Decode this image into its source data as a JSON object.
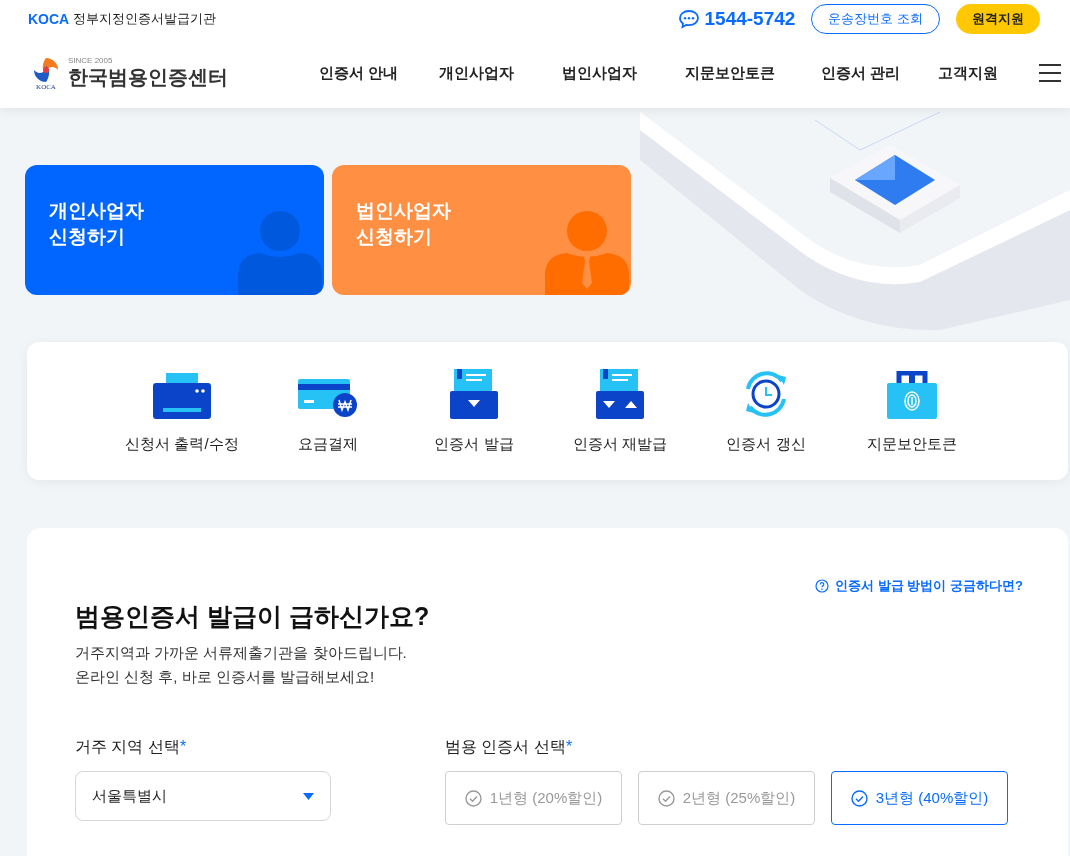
{
  "top_bar": {
    "brand": "KOCA",
    "tagline": "정부지정인증서발급기관",
    "phone": "1544-5742",
    "buttons": [
      "운송장번호 조회",
      "원격지원"
    ]
  },
  "logo": {
    "mark_text": "KOCA",
    "since": "SINCE 2005",
    "name": "한국범용인증센터"
  },
  "nav": [
    "인증서 안내",
    "개인사업자",
    "법인사업자",
    "지문보안토큰",
    "인증서 관리",
    "고객지원"
  ],
  "apply_cards": [
    {
      "kind": "individual",
      "lines": [
        "개인사업자",
        "신청하기"
      ]
    },
    {
      "kind": "corporate",
      "lines": [
        "법인사업자",
        "신청하기"
      ]
    }
  ],
  "services": [
    {
      "kind": "printer",
      "label": "신청서 출력/수정"
    },
    {
      "kind": "payment",
      "label": "요금결제"
    },
    {
      "kind": "issue",
      "label": "인증서 발급"
    },
    {
      "kind": "reissue",
      "label": "인증서 재발급"
    },
    {
      "kind": "renew",
      "label": "인증서 갱신"
    },
    {
      "kind": "token",
      "label": "지문보안토큰"
    }
  ],
  "form": {
    "help_link": "인증서 발급 방법이 궁금하다면?",
    "title": "범용인증서 발급이 급하신가요?",
    "description": [
      "거주지역과 가까운 서류제출기관을 찾아드립니다.",
      "온라인 신청 후, 바로 인증서를 발급해보세요!"
    ],
    "region": {
      "label": "거주 지역 선택",
      "required_mark": "*",
      "value": "서울특별시"
    },
    "certificate": {
      "label": "범용 인증서 선택",
      "required_mark": "*",
      "options": [
        {
          "label": "1년형 (20%할인)",
          "selected": false
        },
        {
          "label": "2년형 (25%할인)",
          "selected": false
        },
        {
          "label": "3년형 (40%할인)",
          "selected": true
        }
      ]
    }
  }
}
